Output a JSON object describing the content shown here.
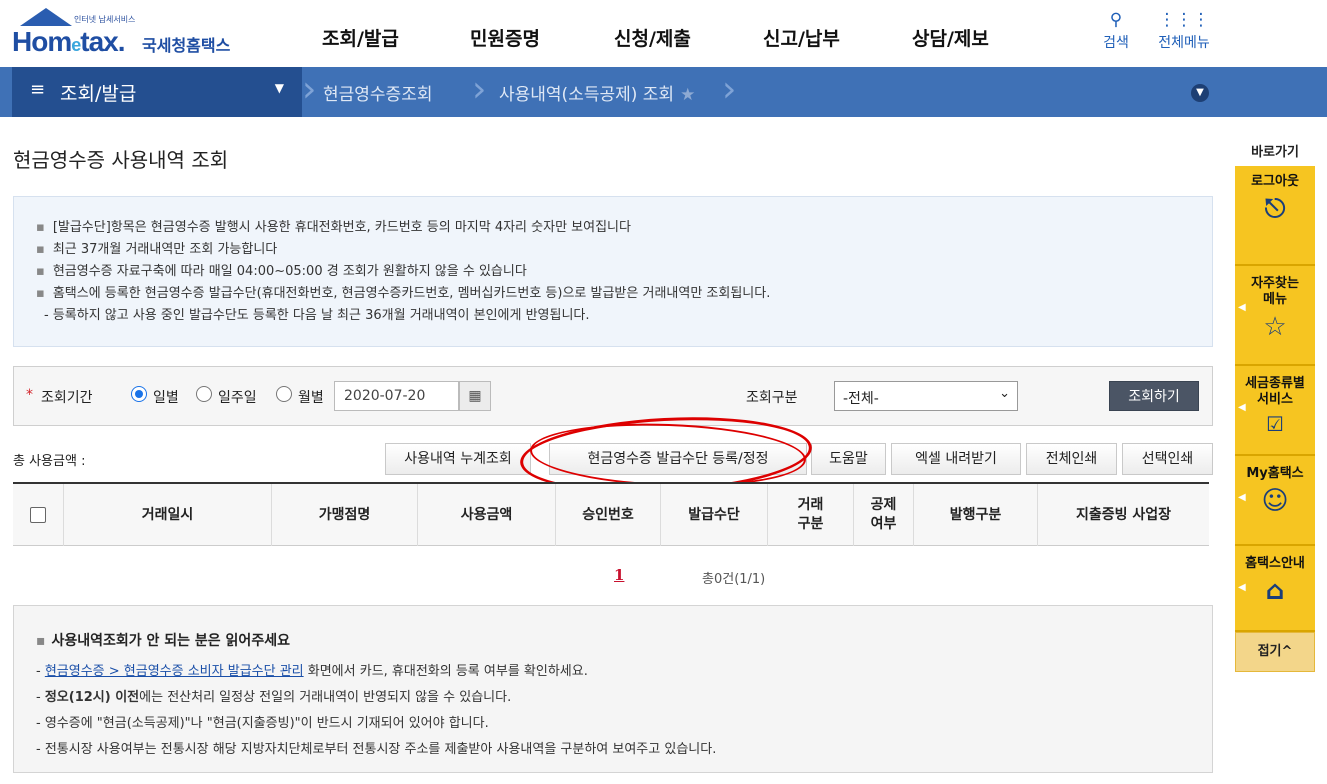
{
  "header": {
    "logo_small": "인터넷 납세서비스",
    "logo_text": "Hom",
    "logo_e": "e",
    "logo_text2": "tax.",
    "logo_kr": "국세청홈택스",
    "nav": [
      "조회/발급",
      "민원증명",
      "신청/제출",
      "신고/납부",
      "상담/제보"
    ],
    "search_label": "검색",
    "allmenu_label": "전체메뉴"
  },
  "breadcrumb": {
    "menu_icon": "≡",
    "current": "조회/발급",
    "seg1": "현금영수증조회",
    "seg2": "사용내역(소득공제) 조회"
  },
  "page_title": "현금영수증 사용내역 조회",
  "notice": [
    "[발급수단]항목은 현금영수증 발행시 사용한 휴대전화번호, 카드번호 등의 마지막 4자리 숫자만 보여집니다",
    "최근 37개월 거래내역만 조회 가능합니다",
    "현금영수증 자료구축에 따라 매일 04:00~05:00 경 조회가 원활하지 않을 수 있습니다",
    "홈택스에 등록한 현금영수증 발급수단(휴대전화번호, 현금영수증카드번호, 멤버십카드번호 등)으로 발급받은 거래내역만 조회됩니다."
  ],
  "notice_sub": "- 등록하지 않고 사용 중인 발급수단도 등록한 다음 날 최근 36개월 거래내역이 본인에게 반영됩니다.",
  "search": {
    "required_mark": "*",
    "period_label": "조회기간",
    "opt_daily": "일별",
    "opt_weekly": "일주일",
    "opt_monthly": "월별",
    "date_value": "2020-07-20",
    "type_label": "조회구분",
    "type_value": "-전체-",
    "submit": "조회하기"
  },
  "toolbar": {
    "total_label": "총 사용금액 :",
    "btn_cumulative": "사용내역 누계조회",
    "btn_register": "현금영수증 발급수단 등록/정정",
    "btn_help": "도움말",
    "btn_excel": "엑셀 내려받기",
    "btn_print_all": "전체인쇄",
    "btn_print_sel": "선택인쇄"
  },
  "table": {
    "columns": [
      "거래일시",
      "가맹점명",
      "사용금액",
      "승인번호",
      "발급수단",
      "거래 구분",
      "공제 여부",
      "발행구분",
      "지출증빙 사업장"
    ]
  },
  "pagination": {
    "page": "1",
    "count": "총0건(1/1)"
  },
  "info": {
    "head": "사용내역조회가 안 되는 분은 읽어주세요",
    "link": "현금영수증 > 현금영수증 소비자 발급수단 관리",
    "line1_rest": " 화면에서 카드, 휴대전화의 등록 여부를 확인하세요.",
    "line2_bold": "정오(12시) 이전",
    "line2_rest": "에는 전산처리 일정상 전일의 거래내역이 반영되지 않을 수 있습니다.",
    "line3": "영수증에 \"현금(소득공제)\"나 \"현금(지출증빙)\"이 반드시 기재되어 있어야 합니다.",
    "line4": "전통시장 사용여부는 전통시장 해당 지방자치단체로부터 전통시장 주소를 제출받아 사용내역을 구분하여 보여주고 있습니다."
  },
  "quick": {
    "title": "바로가기",
    "logout": "로그아웃",
    "favorites": "자주찾는 메뉴",
    "tax_service": "세금종류별 서비스",
    "my_hometax": "My홈택스",
    "guide": "홈택스안내",
    "fold": "접기^"
  }
}
